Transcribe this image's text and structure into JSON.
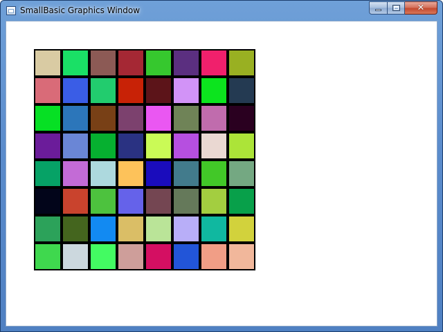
{
  "window": {
    "title": "SmallBasic Graphics Window",
    "icons": {
      "app": "window-icon",
      "minimize": "minimize-icon",
      "maximize": "maximize-icon",
      "close": "close-icon"
    },
    "close_glyph": "✕"
  },
  "canvas": {
    "rows": 8,
    "cols": 8,
    "cell_border_color": "#000000",
    "background": "#ffffff",
    "colors": [
      [
        "#D9CBA3",
        "#1AE066",
        "#8C5A55",
        "#A52834",
        "#36C82E",
        "#5B2F80",
        "#F0206C",
        "#99B022"
      ],
      [
        "#D96B78",
        "#3A5DE6",
        "#22CC6E",
        "#C82206",
        "#5C1419",
        "#D293F7",
        "#0CE41E",
        "#243A52"
      ],
      [
        "#06E024",
        "#2C76BA",
        "#784016",
        "#7C416E",
        "#EA57F2",
        "#6F8357",
        "#C06CAD",
        "#2A0020"
      ],
      [
        "#6B1C9A",
        "#6A86D6",
        "#06B030",
        "#2A3282",
        "#CAFA56",
        "#B64FE0",
        "#EAD8D2",
        "#ACE438"
      ],
      [
        "#06A266",
        "#C36BD6",
        "#ADD9DE",
        "#FDC25A",
        "#1A0CBC",
        "#427B8C",
        "#42C828",
        "#74A882"
      ],
      [
        "#02051A",
        "#C9432D",
        "#4DC23E",
        "#6562EA",
        "#744652",
        "#65795A",
        "#A3CE40",
        "#08A04A"
      ],
      [
        "#2CA25A",
        "#44651E",
        "#128AF2",
        "#DABE66",
        "#BAE498",
        "#B8AEF8",
        "#10B8A0",
        "#D2D23C"
      ],
      [
        "#3FD84E",
        "#CCD8DE",
        "#43FB62",
        "#CE9E9A",
        "#D40F62",
        "#2255D8",
        "#F19E86",
        "#F1B79B"
      ]
    ]
  }
}
